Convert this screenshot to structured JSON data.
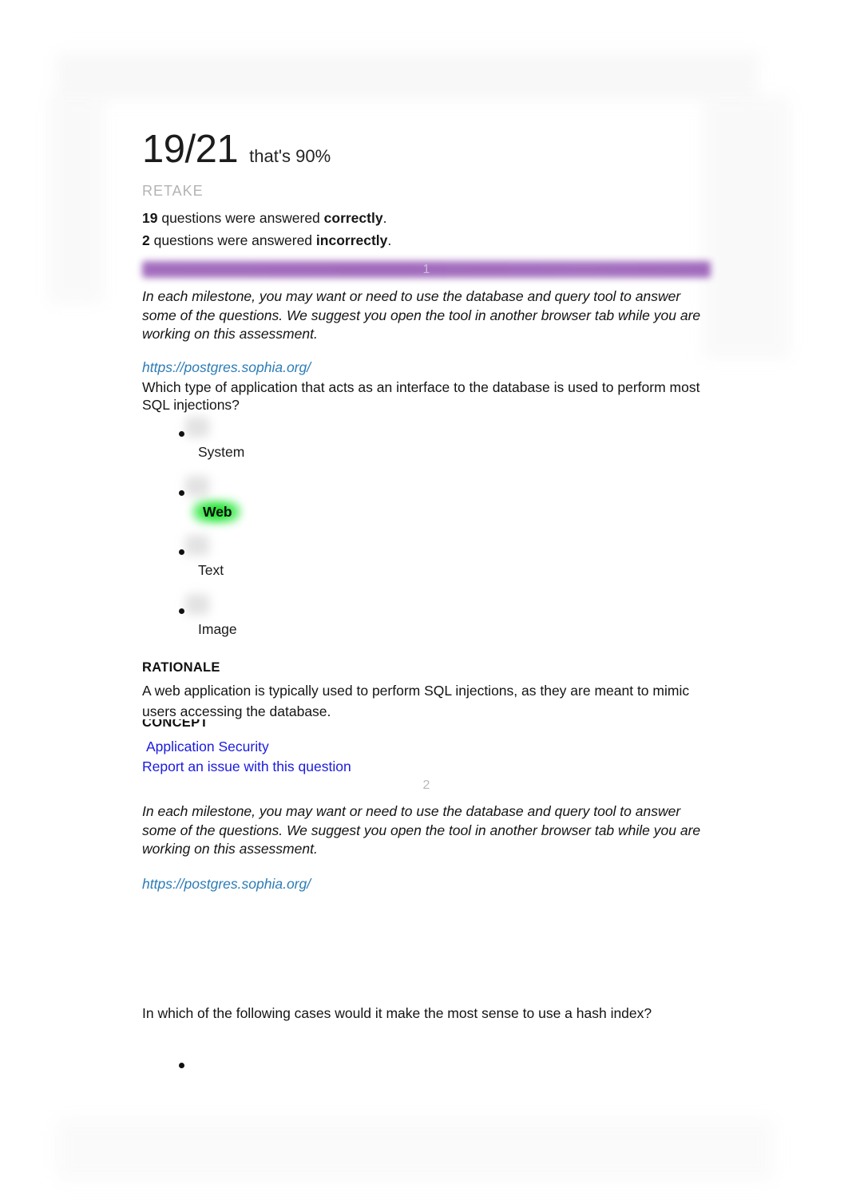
{
  "header": {
    "score": "19/21",
    "score_caption": "that's 90%",
    "retake_label": "RETAKE",
    "correct_count": "19",
    "correct_text_before": " questions were answered ",
    "correct_word": "correctly",
    "period": ".",
    "incorrect_count": "2",
    "incorrect_text_before": " questions were answered ",
    "incorrect_word": "incorrectly"
  },
  "colors": {
    "banner_purple": "#9c63b9",
    "correct_highlight_green": "#1fe02f",
    "link_blue": "#1a1ae0",
    "url_blue": "#2c7cb6",
    "retake_gray": "#b3b3b3"
  },
  "shared": {
    "milestone_note": "In each milestone, you may want or need to use the database and query tool to answer some of the questions. We suggest you open the tool in another browser tab while you are working on this assessment.",
    "postgres_url": "https://postgres.sophia.org/"
  },
  "questions": [
    {
      "number": "1",
      "number_style": "banner",
      "prompt": "Which type of application that acts as an interface to the database is used to perform most SQL injections?",
      "options": [
        {
          "label": "System",
          "correct": false
        },
        {
          "label": "Web",
          "correct": true
        },
        {
          "label": "Text",
          "correct": false
        },
        {
          "label": "Image",
          "correct": false
        }
      ],
      "rationale_heading": "RATIONALE",
      "rationale_body": "A web application is typically used to perform SQL injections, as they are meant to mimic users accessing the database.",
      "concept_heading": "CONCEPT",
      "concept_link": "Application Security",
      "report_link": "Report an issue with this question"
    },
    {
      "number": "2",
      "number_style": "plain",
      "prompt": "In which of the following cases would it make the most sense to use a hash index?",
      "options": [
        {
          "label": "",
          "correct": false
        }
      ]
    }
  ]
}
